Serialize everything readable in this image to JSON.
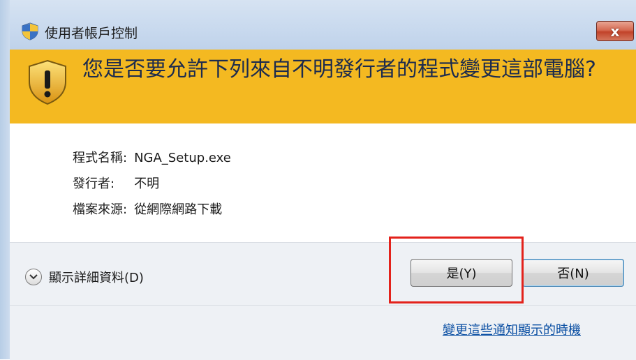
{
  "window": {
    "title": "使用者帳戶控制",
    "close_label": "x"
  },
  "banner": {
    "question": "您是否要允許下列來自不明發行者的程式變更這部電腦?"
  },
  "program_info": {
    "program_name_label": "程式名稱:",
    "program_name_value": "NGA_Setup.exe",
    "publisher_label": "發行者:",
    "publisher_value": "不明",
    "source_label": "檔案來源:",
    "source_value": "從網際網路下載"
  },
  "footer": {
    "details_label": "顯示詳細資料(D)",
    "yes_label": "是(Y)",
    "no_label": "否(N)",
    "notify_link": "變更這些通知顯示的時機"
  },
  "colors": {
    "banner": "#f4b921",
    "highlight": "#e3221b",
    "link": "#0a4fa3"
  },
  "icons": {
    "title": "uac-shield-icon",
    "banner": "warning-shield-icon",
    "details": "chevron-down-icon"
  }
}
